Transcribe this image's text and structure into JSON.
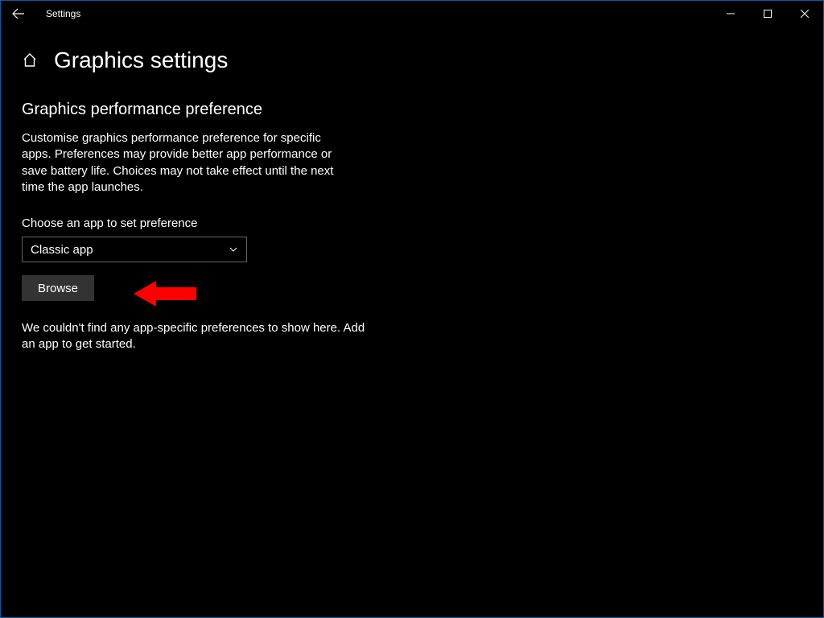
{
  "window": {
    "title": "Settings"
  },
  "page": {
    "title": "Graphics settings"
  },
  "section": {
    "heading": "Graphics performance preference",
    "description": "Customise graphics performance preference for specific apps. Preferences may provide better app performance or save battery life. Choices may not take effect until the next time the app launches."
  },
  "chooser": {
    "label": "Choose an app to set preference",
    "selected": "Classic app",
    "browse_label": "Browse"
  },
  "empty_state": "We couldn't find any app-specific preferences to show here. Add an app to get started."
}
